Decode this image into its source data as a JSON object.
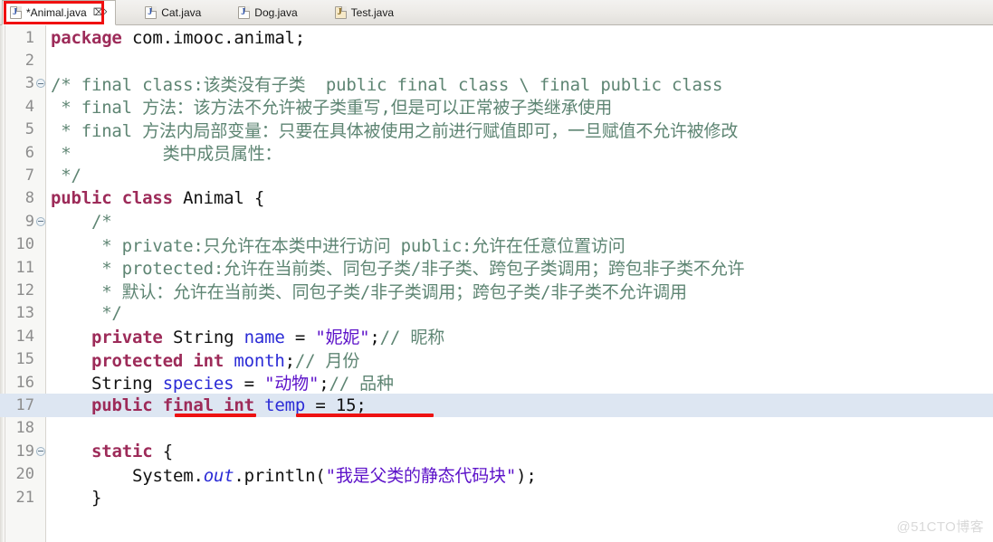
{
  "window": {
    "app": "Eclipse Java Editor",
    "watermark": "@51CTO博客"
  },
  "tabs": [
    {
      "label": "*Animal.java",
      "icon": "java-file-icon",
      "active": true,
      "close_glyph": "⌦"
    },
    {
      "label": "Cat.java",
      "icon": "java-file-icon",
      "active": false,
      "close_glyph": ""
    },
    {
      "label": "Dog.java",
      "icon": "java-file-icon",
      "active": false,
      "close_glyph": ""
    },
    {
      "label": "Test.java",
      "icon": "java-file-locked-icon",
      "active": false,
      "close_glyph": ""
    }
  ],
  "annotations": {
    "tab_box_color": "#f01010",
    "underline_color": "#ee1212",
    "underline_1_text": "final int",
    "underline_2_text": "temp = 15;"
  },
  "editor": {
    "highlighted_line": 17,
    "highlight_color": "#dde6f2",
    "colors": {
      "keyword": "#9d2b59",
      "comment": "#5e8573",
      "string": "#5c12c9",
      "field": "#2b2bd6",
      "plain": "#111111",
      "linenumber": "#8d8d8d"
    },
    "lines": [
      {
        "n": "1",
        "fold": false,
        "text": "package com.imooc.animal;"
      },
      {
        "n": "2",
        "fold": false,
        "text": ""
      },
      {
        "n": "3",
        "fold": true,
        "text": "/* final class:该类没有子类  public final class \\ final public class"
      },
      {
        "n": "4",
        "fold": false,
        "text": " * final 方法：该方法不允许被子类重写,但是可以正常被子类继承使用"
      },
      {
        "n": "5",
        "fold": false,
        "text": " * final 方法内局部变量：只要在具体被使用之前进行赋值即可，一旦赋值不允许被修改"
      },
      {
        "n": "6",
        "fold": false,
        "text": " *         类中成员属性："
      },
      {
        "n": "7",
        "fold": false,
        "text": " */"
      },
      {
        "n": "8",
        "fold": false,
        "text": "public class Animal {"
      },
      {
        "n": "9",
        "fold": true,
        "text": "    /*"
      },
      {
        "n": "10",
        "fold": false,
        "text": "     * private:只允许在本类中进行访问 public:允许在任意位置访问"
      },
      {
        "n": "11",
        "fold": false,
        "text": "     * protected:允许在当前类、同包子类/非子类、跨包子类调用；跨包非子类不允许"
      },
      {
        "n": "12",
        "fold": false,
        "text": "     * 默认：允许在当前类、同包子类/非子类调用；跨包子类/非子类不允许调用"
      },
      {
        "n": "13",
        "fold": false,
        "text": "     */"
      },
      {
        "n": "14",
        "fold": false,
        "text": "    private String name = \"妮妮\";// 昵称"
      },
      {
        "n": "15",
        "fold": false,
        "text": "    protected int month;// 月份"
      },
      {
        "n": "16",
        "fold": false,
        "text": "    String species = \"动物\";// 品种"
      },
      {
        "n": "17",
        "fold": false,
        "text": "    public final int temp = 15;"
      },
      {
        "n": "18",
        "fold": false,
        "text": ""
      },
      {
        "n": "19",
        "fold": true,
        "text": "    static {"
      },
      {
        "n": "20",
        "fold": false,
        "text": "        System.out.println(\"我是父类的静态代码块\");"
      },
      {
        "n": "21",
        "fold": false,
        "text": "    }"
      }
    ]
  }
}
